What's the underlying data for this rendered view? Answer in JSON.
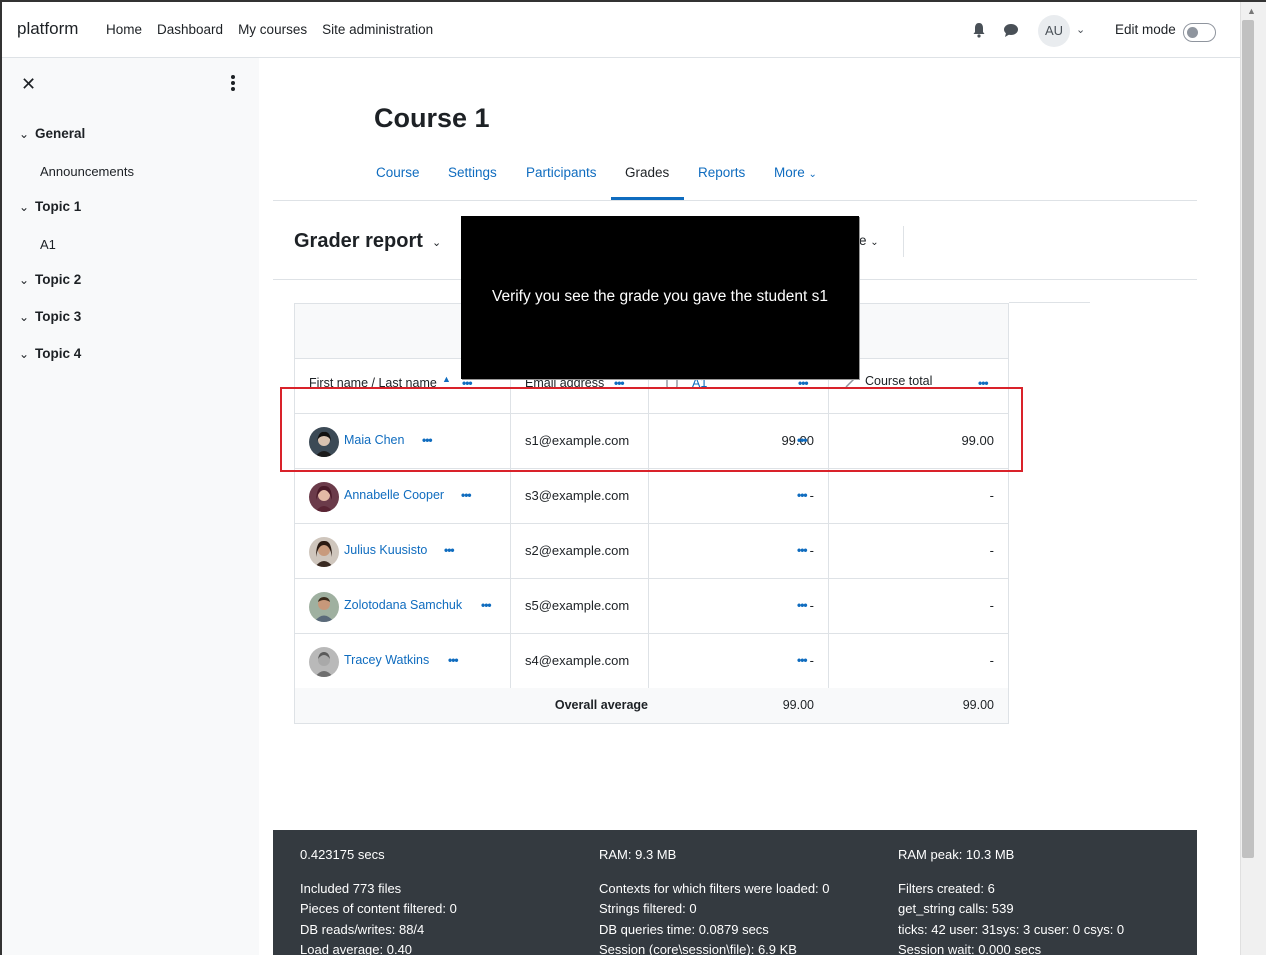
{
  "navbar": {
    "brand": "platform",
    "links": [
      "Home",
      "Dashboard",
      "My courses",
      "Site administration"
    ],
    "user_initials": "AU",
    "edit_mode_label": "Edit mode"
  },
  "course_index": {
    "sections": [
      {
        "title": "General",
        "items": [
          "Announcements"
        ]
      },
      {
        "title": "Topic 1",
        "items": [
          "A1"
        ]
      },
      {
        "title": "Topic 2",
        "items": []
      },
      {
        "title": "Topic 3",
        "items": []
      },
      {
        "title": "Topic 4",
        "items": []
      }
    ]
  },
  "course": {
    "title": "Course 1",
    "tabs": [
      "Course",
      "Settings",
      "Participants",
      "Grades",
      "Reports",
      "More"
    ],
    "active_tab": "Grades"
  },
  "grader": {
    "title": "Grader report",
    "partial_dropdown_text": "e",
    "columns": {
      "name": "First name / Last name",
      "email": "Email address",
      "item": "A1",
      "total": "Course total"
    },
    "rows": [
      {
        "name": "Maia Chen",
        "email": "s1@example.com",
        "grade": "99.00",
        "total": "99.00"
      },
      {
        "name": "Annabelle Cooper",
        "email": "s3@example.com",
        "grade": "-",
        "total": "-"
      },
      {
        "name": "Julius Kuusisto",
        "email": "s2@example.com",
        "grade": "-",
        "total": "-"
      },
      {
        "name": "Zolotodana Samchuk",
        "email": "s5@example.com",
        "grade": "-",
        "total": "-"
      },
      {
        "name": "Tracey Watkins",
        "email": "s4@example.com",
        "grade": "-",
        "total": "-"
      }
    ],
    "average": {
      "label": "Overall average",
      "grade": "99.00",
      "total": "99.00"
    }
  },
  "overlay": {
    "message": "Verify you see the grade you gave the student s1"
  },
  "footer": {
    "col1": [
      "0.423175 secs",
      "",
      "Included 773 files",
      "Pieces of content filtered: 0",
      "DB reads/writes: 88/4",
      "Load average: 0.40"
    ],
    "col2": [
      "RAM: 9.3 MB",
      "",
      "Contexts for which filters were loaded: 0",
      "Strings filtered: 0",
      "DB queries time: 0.0879 secs",
      "Session (core\\session\\file): 6.9 KB"
    ],
    "col3": [
      "RAM peak: 10.3 MB",
      "",
      "Filters created: 6",
      "get_string calls: 539",
      "ticks: 42 user: 31sys: 3 cuser: 0 csys: 0",
      "Session wait: 0.000 secs"
    ]
  },
  "colors": {
    "link": "#0f6cbf",
    "highlight_border": "#d9222a",
    "footer_bg": "#343a40",
    "overlay_bg": "#000000"
  }
}
